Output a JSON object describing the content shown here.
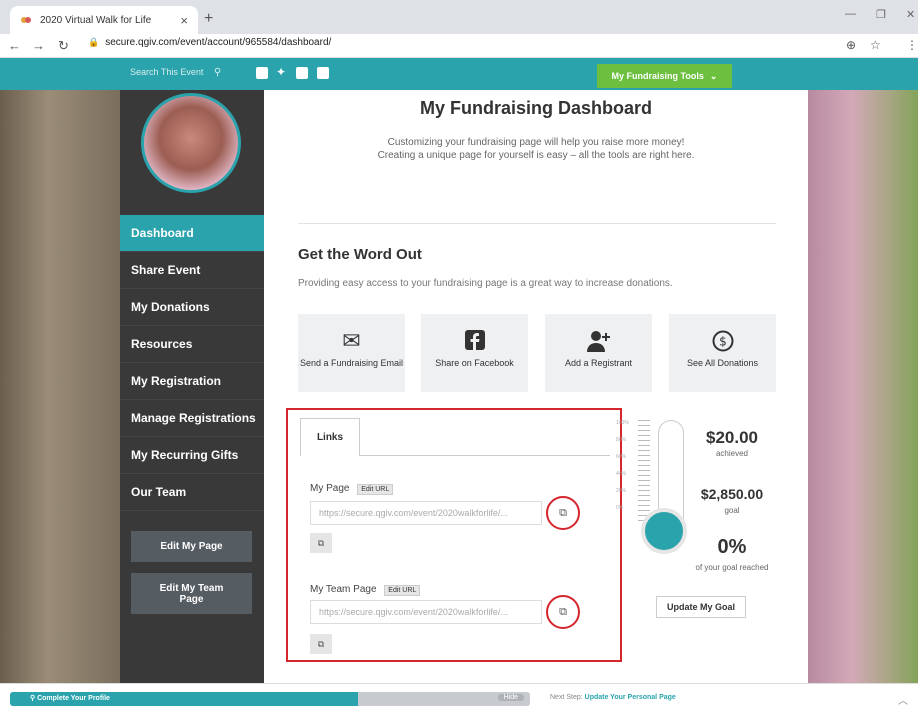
{
  "browser": {
    "tab_title": "2020 Virtual Walk for Life",
    "url": "secure.qgiv.com/event/account/965584/dashboard/"
  },
  "site": {
    "search_placeholder": "Search This Event",
    "fundraising_tools": "My Fundraising Tools"
  },
  "sidebar": {
    "items": [
      {
        "label": "Dashboard"
      },
      {
        "label": "Share Event"
      },
      {
        "label": "My Donations"
      },
      {
        "label": "Resources"
      },
      {
        "label": "My Registration"
      },
      {
        "label": "Manage Registrations"
      },
      {
        "label": "My Recurring Gifts"
      },
      {
        "label": "Our Team"
      }
    ],
    "edit_my_page": "Edit My Page",
    "edit_my_team_page": "Edit My Team Page"
  },
  "main": {
    "title": "My Fundraising Dashboard",
    "subtitle": "Customizing your fundraising page will help you raise more money! Creating a unique page for yourself is easy – all the tools are right here.",
    "section_title": "Get the Word Out",
    "section_desc": "Providing easy access to your fundraising page is a great way to increase donations.",
    "tiles": [
      {
        "label": "Send a Fundraising Email",
        "icon": "envelope-icon"
      },
      {
        "label": "Share on Facebook",
        "icon": "facebook-icon"
      },
      {
        "label": "Add a Registrant",
        "icon": "add-user-icon"
      },
      {
        "label": "See All Donations",
        "icon": "dollar-icon"
      }
    ]
  },
  "links": {
    "tab_label": "Links",
    "my_page_label": "My Page",
    "my_team_page_label": "My Team Page",
    "edit_url": "Edit URL",
    "my_page_url": "https://secure.qgiv.com/event/2020walkforlife/...",
    "my_team_page_url": "https://secure.qgiv.com/event/2020walkforlife/..."
  },
  "goal": {
    "achieved_amount": "$20.00",
    "achieved_label": "achieved",
    "goal_amount": "$2,850.00",
    "goal_label": "goal",
    "percent": "0%",
    "percent_label": "of your goal reached",
    "update_button": "Update My Goal",
    "ticks": [
      "100%",
      "80%",
      "60%",
      "40%",
      "20%",
      "0%"
    ]
  },
  "footer": {
    "complete_profile": "Complete Your Profile",
    "progress_fraction": 0.67,
    "hide": "Hide",
    "next_step_prefix": "Next Step:",
    "next_step_link": "Update Your Personal Page"
  },
  "colors": {
    "accent": "#2aa3ac",
    "tools_green": "#6cbf3f",
    "highlight_red": "#d5262e",
    "sidebar": "#393939"
  }
}
